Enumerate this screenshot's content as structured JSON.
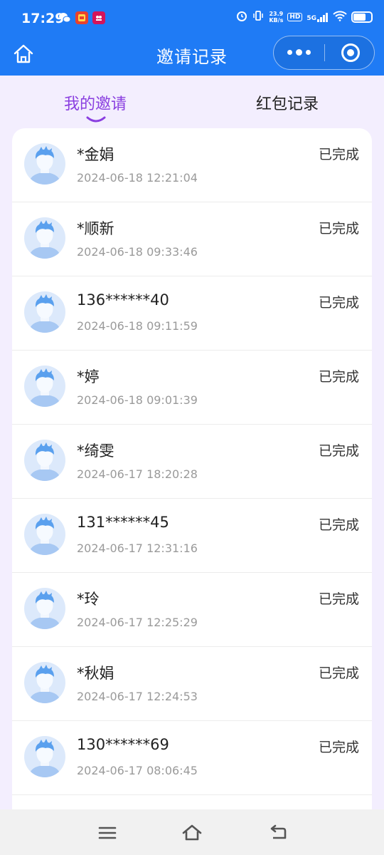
{
  "status_bar": {
    "time": "17:29",
    "speed_value": "23.9",
    "speed_unit": "KB/s",
    "hd": "HD",
    "network": "5G",
    "battery_level": 0.7,
    "icons": [
      "wechat-icon",
      "app-icon-1",
      "app-icon-2",
      "alarm-icon",
      "vibrate-icon",
      "signal-icon",
      "wifi-icon",
      "battery-icon"
    ]
  },
  "nav": {
    "title": "邀请记录"
  },
  "tabs": [
    {
      "label": "我的邀请",
      "active": true
    },
    {
      "label": "红包记录",
      "active": false
    }
  ],
  "colors": {
    "primary": "#1f7bf5",
    "accent": "#8a3fe0",
    "background": "#f3eefe"
  },
  "records": [
    {
      "name": "*金娟",
      "time": "2024-06-18 12:21:04",
      "status": "已完成"
    },
    {
      "name": "*顺新",
      "time": "2024-06-18 09:33:46",
      "status": "已完成"
    },
    {
      "name": "136******40",
      "time": "2024-06-18 09:11:59",
      "status": "已完成"
    },
    {
      "name": "*婷",
      "time": "2024-06-18 09:01:39",
      "status": "已完成"
    },
    {
      "name": "*绮雯",
      "time": "2024-06-17 18:20:28",
      "status": "已完成"
    },
    {
      "name": "131******45",
      "time": "2024-06-17 12:31:16",
      "status": "已完成"
    },
    {
      "name": "*玲",
      "time": "2024-06-17 12:25:29",
      "status": "已完成"
    },
    {
      "name": "*秋娟",
      "time": "2024-06-17 12:24:53",
      "status": "已完成"
    },
    {
      "name": "130******69",
      "time": "2024-06-17 08:06:45",
      "status": "已完成"
    }
  ],
  "bottom_nav": [
    "menu-icon",
    "home-icon",
    "back-icon"
  ]
}
